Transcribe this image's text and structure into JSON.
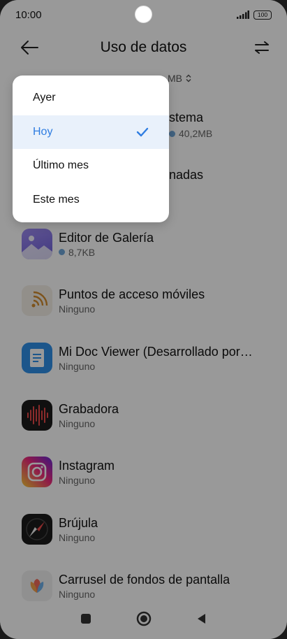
{
  "status_bar": {
    "time": "10:00",
    "battery": "100"
  },
  "header": {
    "title": "Uso de datos"
  },
  "period_selector": {
    "value_partial": "MB"
  },
  "system_row": {
    "name_partial": "stema",
    "usage": "40,2MB"
  },
  "background_row": {
    "name_partial": "nadas"
  },
  "dropdown": {
    "options": [
      {
        "label": "Ayer"
      },
      {
        "label": "Hoy"
      },
      {
        "label": "Último mes"
      },
      {
        "label": "Este mes"
      }
    ],
    "selected_index": 1
  },
  "apps": [
    {
      "name": "Editor de Galería",
      "usage": "8,7KB",
      "icon": "gallery-editor-icon"
    },
    {
      "name": "Puntos de acceso móviles",
      "usage": "Ninguno",
      "icon": "hotspot-icon"
    },
    {
      "name": "Mi Doc Viewer (Desarrollado por…",
      "usage": "Ninguno",
      "icon": "doc-viewer-icon"
    },
    {
      "name": "Grabadora",
      "usage": "Ninguno",
      "icon": "recorder-icon"
    },
    {
      "name": "Instagram",
      "usage": "Ninguno",
      "icon": "instagram-icon"
    },
    {
      "name": "Brújula",
      "usage": "Ninguno",
      "icon": "compass-icon"
    },
    {
      "name": "Carrusel de fondos de pantalla",
      "usage": "Ninguno",
      "icon": "wallpaper-carousel-icon"
    }
  ],
  "colors": {
    "accent": "#2f7de1",
    "selected_bg": "#e9f1fb",
    "usage_dot": "#6fa6d8"
  }
}
